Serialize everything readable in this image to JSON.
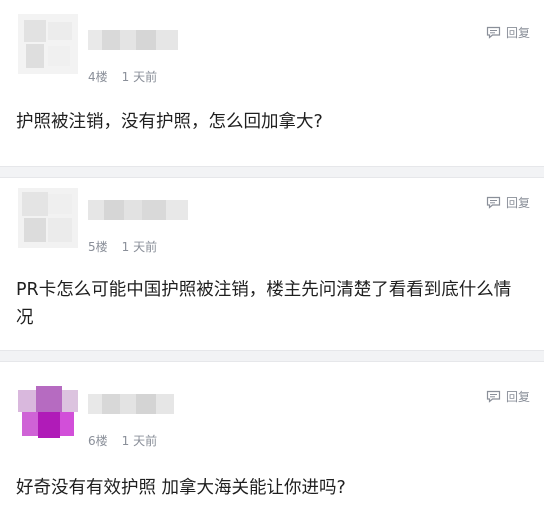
{
  "comments": [
    {
      "floor": "4楼",
      "time": "1 天前",
      "reply_label": "回复",
      "text": "护照被注销，没有护照，怎么回加拿大?"
    },
    {
      "floor": "5楼",
      "time": "1 天前",
      "reply_label": "回复",
      "text": "PR卡怎么可能中国护照被注销，楼主先问清楚了看看到底什么情况"
    },
    {
      "floor": "6楼",
      "time": "1 天前",
      "reply_label": "回复",
      "text": "好奇没有有效护照 加拿大海关能让你进吗?"
    }
  ],
  "icons": {
    "reply": "comment-reply-icon"
  },
  "colors": {
    "meta_text": "#8a8f99",
    "content_text": "#1f1f1f",
    "divider": "#f2f3f5",
    "avatar_accent": "#b01bb8"
  }
}
